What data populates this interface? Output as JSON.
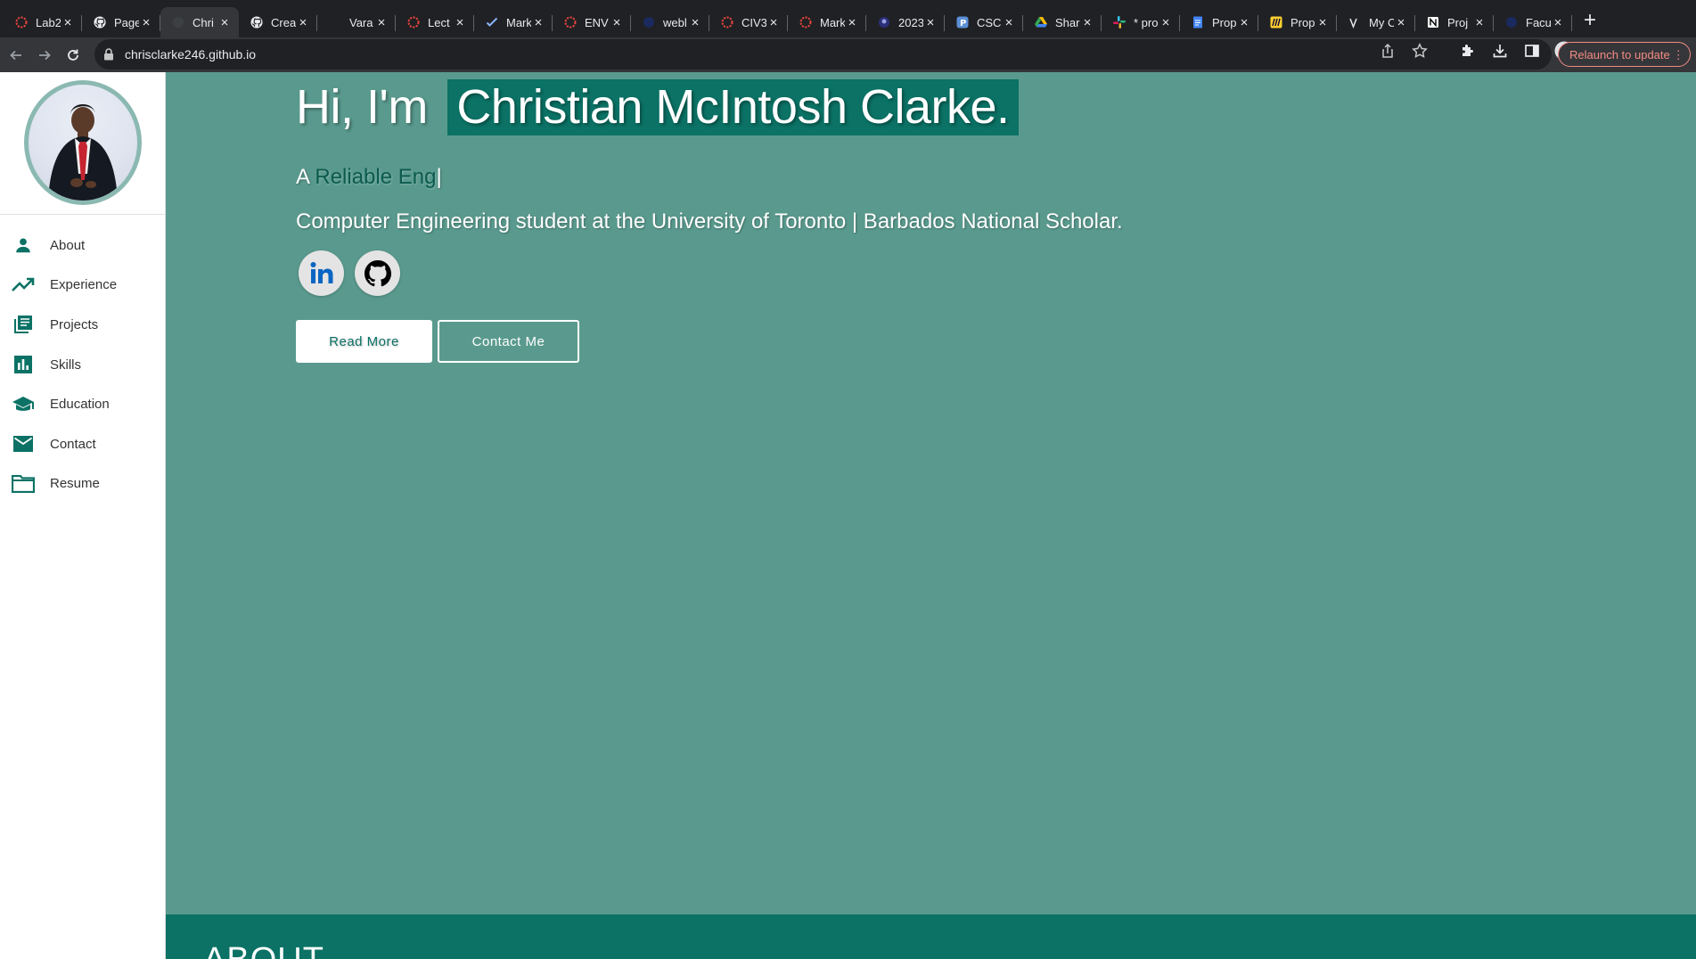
{
  "browser": {
    "tabs": [
      {
        "title": "Lab2",
        "icon": "red-dotted-circle-icon",
        "active": false
      },
      {
        "title": "Page",
        "icon": "github-icon",
        "active": false
      },
      {
        "title": "Chri",
        "icon": "globe-icon",
        "active": true
      },
      {
        "title": "Crea",
        "icon": "github-icon",
        "active": false
      },
      {
        "title": "Vara",
        "icon": "blank-icon",
        "active": false
      },
      {
        "title": "Lect",
        "icon": "red-dotted-circle-icon",
        "active": false
      },
      {
        "title": "Mark",
        "icon": "checkmark-icon",
        "active": false
      },
      {
        "title": "ENV",
        "icon": "red-dotted-circle-icon",
        "active": false
      },
      {
        "title": "webl",
        "icon": "navy-shield-icon",
        "active": false
      },
      {
        "title": "CIV3",
        "icon": "red-dotted-circle-icon",
        "active": false
      },
      {
        "title": "Mark",
        "icon": "red-dotted-circle-icon",
        "active": false
      },
      {
        "title": "2023",
        "icon": "navy-crest-icon",
        "active": false
      },
      {
        "title": "CSC",
        "icon": "p-square-icon",
        "active": false
      },
      {
        "title": "Shar",
        "icon": "google-drive-icon",
        "active": false
      },
      {
        "title": "* pro",
        "icon": "slack-icon",
        "active": false
      },
      {
        "title": "Prop",
        "icon": "google-docs-icon",
        "active": false
      },
      {
        "title": "Prop",
        "icon": "miro-icon",
        "active": false
      },
      {
        "title": "My C",
        "icon": "vercel-icon",
        "active": false
      },
      {
        "title": "Proj",
        "icon": "notion-icon",
        "active": false
      },
      {
        "title": "Facu",
        "icon": "navy-shield-icon",
        "active": false
      }
    ],
    "new_tab": "+",
    "url": "chrisclarke246.github.io",
    "relaunch_label": "Relaunch to update"
  },
  "sidebar": {
    "items": [
      {
        "label": "About",
        "icon": "person-icon"
      },
      {
        "label": "Experience",
        "icon": "trending-up-icon"
      },
      {
        "label": "Projects",
        "icon": "library-books-icon"
      },
      {
        "label": "Skills",
        "icon": "bar-chart-icon"
      },
      {
        "label": "Education",
        "icon": "graduation-cap-icon"
      },
      {
        "label": "Contact",
        "icon": "mail-icon"
      },
      {
        "label": "Resume",
        "icon": "folder-icon"
      }
    ]
  },
  "hero": {
    "greeting": "Hi, I'm",
    "name": "Christian McIntosh Clarke.",
    "typed_prefix": "A",
    "typed_text": "Reliable Eng",
    "typed_cursor": "|",
    "tagline": "Computer Engineering student at the University of Toronto | Barbados National Scholar.",
    "socials": [
      {
        "name": "LinkedIn",
        "icon": "linkedin-icon"
      },
      {
        "name": "GitHub",
        "icon": "github-icon"
      }
    ],
    "read_more_label": "Read More",
    "contact_label": "Contact Me"
  },
  "about": {
    "title": "ABOUT"
  },
  "colors": {
    "hero_bg": "#5a9a8e",
    "accent": "#0b7265",
    "sidebar_icon": "#0b7265"
  }
}
